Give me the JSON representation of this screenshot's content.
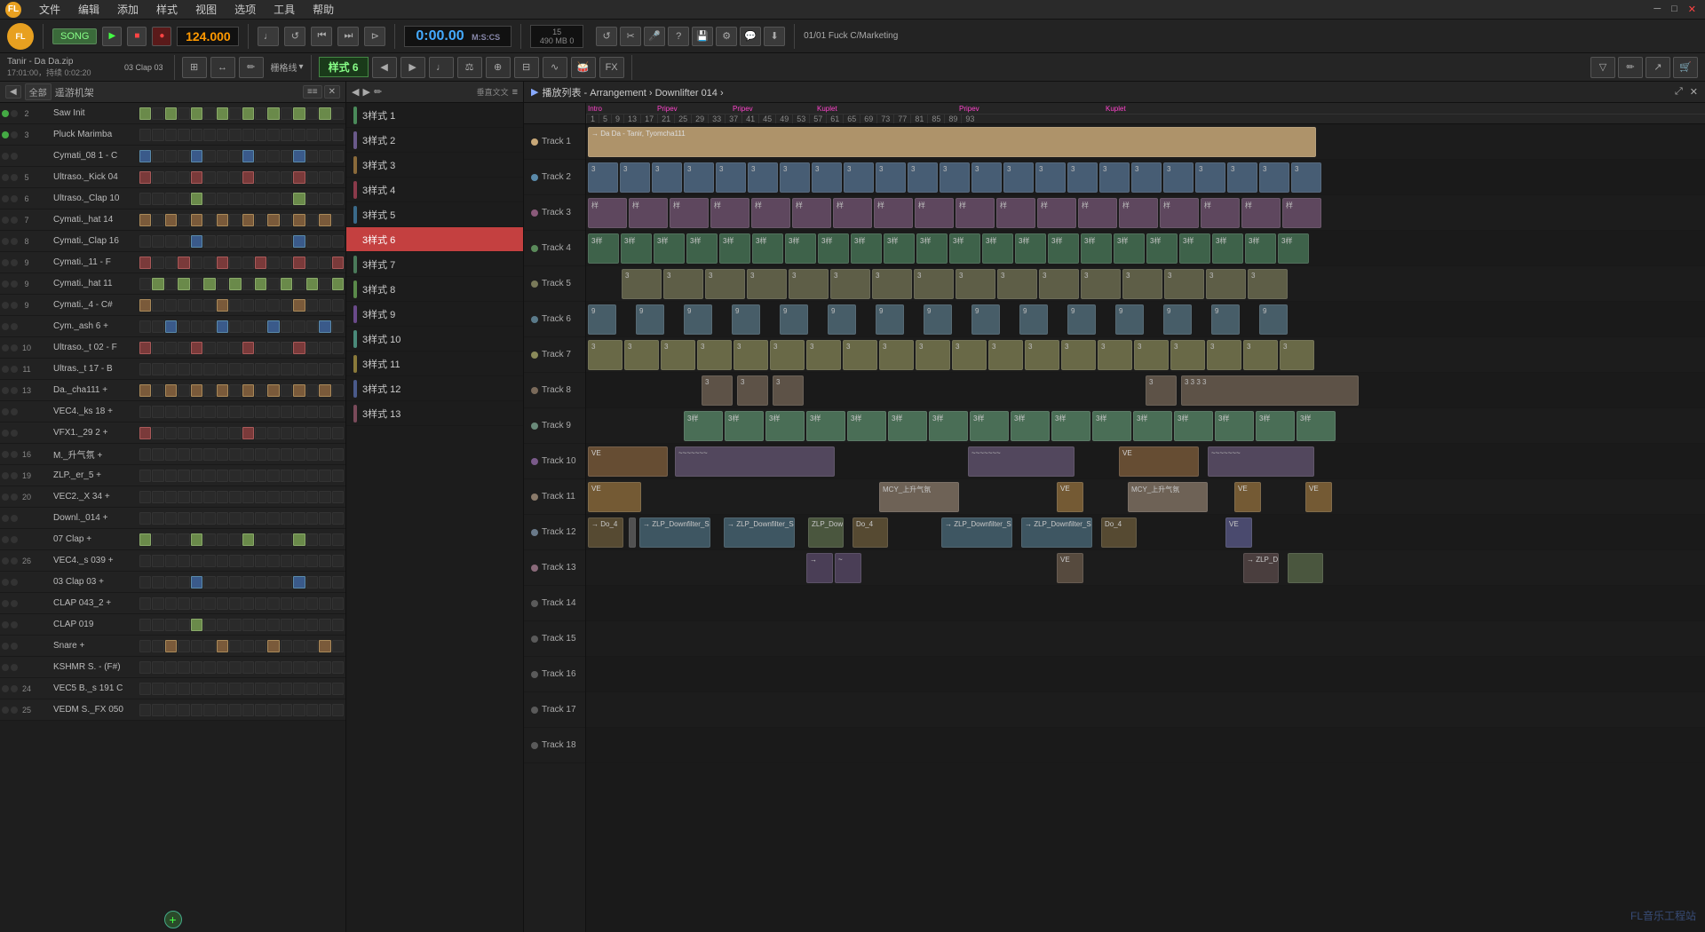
{
  "menu": {
    "items": [
      "文件",
      "编辑",
      "添加",
      "样式",
      "视图",
      "选项",
      "工具",
      "帮助"
    ]
  },
  "transport": {
    "song_label": "SONG",
    "bpm": "124.000",
    "time": "0:00.00",
    "time_unit": "M:S:CS",
    "beats": "15",
    "memory": "490 MB\n0",
    "record_btn": "●",
    "play_btn": "▶",
    "stop_btn": "■",
    "pattern_btn": "样式 6",
    "project_info": "01/01  Fuck C/Marketing"
  },
  "left_panel": {
    "header_btns": [
      "◀",
      "全部",
      "遥游机架"
    ],
    "add_btn": "+"
  },
  "channels": [
    {
      "num": "2",
      "name": "Saw Init",
      "green": true,
      "steps": [
        1,
        0,
        1,
        0,
        1,
        0,
        1,
        0,
        1,
        0,
        1,
        0,
        1,
        0,
        1,
        0
      ]
    },
    {
      "num": "3",
      "name": "Pluck Marimba",
      "green": true,
      "steps": [
        0,
        0,
        0,
        0,
        0,
        0,
        0,
        0,
        0,
        0,
        0,
        0,
        0,
        0,
        0,
        0
      ]
    },
    {
      "num": "",
      "name": "Cymati_08 1 - C",
      "green": false,
      "steps": [
        1,
        0,
        0,
        0,
        1,
        0,
        0,
        0,
        1,
        0,
        0,
        0,
        1,
        0,
        0,
        0
      ]
    },
    {
      "num": "5",
      "name": "Ultraso._Kick 04",
      "green": false,
      "steps": [
        1,
        0,
        0,
        0,
        1,
        0,
        0,
        0,
        1,
        0,
        0,
        0,
        1,
        0,
        0,
        0
      ]
    },
    {
      "num": "6",
      "name": "Ultraso._Clap 10",
      "green": false,
      "steps": [
        0,
        0,
        0,
        0,
        1,
        0,
        0,
        0,
        0,
        0,
        0,
        0,
        1,
        0,
        0,
        0
      ]
    },
    {
      "num": "7",
      "name": "Cymati._hat 14",
      "green": false,
      "steps": [
        1,
        0,
        1,
        0,
        1,
        0,
        1,
        0,
        1,
        0,
        1,
        0,
        1,
        0,
        1,
        0
      ]
    },
    {
      "num": "8",
      "name": "Cymati._Clap 16",
      "green": false,
      "steps": [
        0,
        0,
        0,
        0,
        1,
        0,
        0,
        0,
        0,
        0,
        0,
        0,
        1,
        0,
        0,
        0
      ]
    },
    {
      "num": "9",
      "name": "Cymati._11 - F",
      "green": false,
      "steps": [
        1,
        0,
        0,
        1,
        0,
        0,
        1,
        0,
        0,
        1,
        0,
        0,
        1,
        0,
        0,
        1
      ]
    },
    {
      "num": "9",
      "name": "Cymati._hat 11",
      "green": false,
      "steps": [
        0,
        1,
        0,
        1,
        0,
        1,
        0,
        1,
        0,
        1,
        0,
        1,
        0,
        1,
        0,
        1
      ]
    },
    {
      "num": "9",
      "name": "Cymati._4 - C#",
      "green": false,
      "steps": [
        1,
        0,
        0,
        0,
        0,
        0,
        1,
        0,
        0,
        0,
        0,
        0,
        1,
        0,
        0,
        0
      ]
    },
    {
      "num": "",
      "name": "Cym._ash 6 +",
      "green": false,
      "steps": [
        0,
        0,
        1,
        0,
        0,
        0,
        1,
        0,
        0,
        0,
        1,
        0,
        0,
        0,
        1,
        0
      ]
    },
    {
      "num": "10",
      "name": "Ultraso._t 02 - F",
      "green": false,
      "steps": [
        1,
        0,
        0,
        0,
        1,
        0,
        0,
        0,
        1,
        0,
        0,
        0,
        1,
        0,
        0,
        0
      ]
    },
    {
      "num": "11",
      "name": "Ultras._t 17 - B",
      "green": false,
      "steps": [
        0,
        0,
        0,
        0,
        0,
        0,
        0,
        0,
        0,
        0,
        0,
        0,
        0,
        0,
        0,
        0
      ]
    },
    {
      "num": "13",
      "name": "Da._cha111 +",
      "green": false,
      "steps": [
        1,
        0,
        1,
        0,
        1,
        0,
        1,
        0,
        1,
        0,
        1,
        0,
        1,
        0,
        1,
        0
      ]
    },
    {
      "num": "",
      "name": "VEC4._ks 18 +",
      "green": false,
      "steps": [
        0,
        0,
        0,
        0,
        0,
        0,
        0,
        0,
        0,
        0,
        0,
        0,
        0,
        0,
        0,
        0
      ]
    },
    {
      "num": "",
      "name": "VFX1._29 2 +",
      "green": false,
      "steps": [
        1,
        0,
        0,
        0,
        0,
        0,
        0,
        0,
        1,
        0,
        0,
        0,
        0,
        0,
        0,
        0
      ]
    },
    {
      "num": "16",
      "name": "M._升气氛 +",
      "green": false,
      "steps": [
        0,
        0,
        0,
        0,
        0,
        0,
        0,
        0,
        0,
        0,
        0,
        0,
        0,
        0,
        0,
        0
      ]
    },
    {
      "num": "19",
      "name": "ZLP._er_5 +",
      "green": false,
      "steps": [
        0,
        0,
        0,
        0,
        0,
        0,
        0,
        0,
        0,
        0,
        0,
        0,
        0,
        0,
        0,
        0
      ]
    },
    {
      "num": "20",
      "name": "VEC2._X 34 +",
      "green": false,
      "steps": [
        0,
        0,
        0,
        0,
        0,
        0,
        0,
        0,
        0,
        0,
        0,
        0,
        0,
        0,
        0,
        0
      ]
    },
    {
      "num": "",
      "name": "Downl._014 +",
      "green": false,
      "steps": [
        0,
        0,
        0,
        0,
        0,
        0,
        0,
        0,
        0,
        0,
        0,
        0,
        0,
        0,
        0,
        0
      ]
    },
    {
      "num": "",
      "name": "07 Clap +",
      "green": false,
      "steps": [
        1,
        0,
        0,
        0,
        1,
        0,
        0,
        0,
        1,
        0,
        0,
        0,
        1,
        0,
        0,
        0
      ]
    },
    {
      "num": "26",
      "name": "VEC4._s 039 +",
      "green": false,
      "steps": [
        0,
        0,
        0,
        0,
        0,
        0,
        0,
        0,
        0,
        0,
        0,
        0,
        0,
        0,
        0,
        0
      ]
    },
    {
      "num": "",
      "name": "03 Clap 03 +",
      "green": false,
      "steps": [
        0,
        0,
        0,
        0,
        1,
        0,
        0,
        0,
        0,
        0,
        0,
        0,
        1,
        0,
        0,
        0
      ]
    },
    {
      "num": "",
      "name": "CLAP 043_2 +",
      "green": false,
      "steps": [
        0,
        0,
        0,
        0,
        0,
        0,
        0,
        0,
        0,
        0,
        0,
        0,
        0,
        0,
        0,
        0
      ]
    },
    {
      "num": "",
      "name": "CLAP 019",
      "green": false,
      "steps": [
        0,
        0,
        0,
        0,
        1,
        0,
        0,
        0,
        0,
        0,
        0,
        0,
        0,
        0,
        0,
        0
      ]
    },
    {
      "num": "",
      "name": "Snare +",
      "green": false,
      "steps": [
        0,
        0,
        1,
        0,
        0,
        0,
        1,
        0,
        0,
        0,
        1,
        0,
        0,
        0,
        1,
        0
      ]
    },
    {
      "num": "",
      "name": "KSHMR S. - (F#)",
      "green": false,
      "steps": [
        0,
        0,
        0,
        0,
        0,
        0,
        0,
        0,
        0,
        0,
        0,
        0,
        0,
        0,
        0,
        0
      ]
    },
    {
      "num": "24",
      "name": "VEC5 B._s 191 C",
      "green": false,
      "steps": [
        0,
        0,
        0,
        0,
        0,
        0,
        0,
        0,
        0,
        0,
        0,
        0,
        0,
        0,
        0,
        0
      ]
    },
    {
      "num": "25",
      "name": "VEDM S._FX 050",
      "green": false,
      "steps": [
        0,
        0,
        0,
        0,
        0,
        0,
        0,
        0,
        0,
        0,
        0,
        0,
        0,
        0,
        0,
        0
      ]
    }
  ],
  "patterns": [
    {
      "label": "3样式 1",
      "color": "#4a8a5a",
      "active": false
    },
    {
      "label": "3样式 2",
      "color": "#6a5a8a",
      "active": false
    },
    {
      "label": "3样式 3",
      "color": "#8a6a3a",
      "active": false
    },
    {
      "label": "3样式 4",
      "color": "#8a3a4a",
      "active": false
    },
    {
      "label": "3样式 5",
      "color": "#3a6a8a",
      "active": false
    },
    {
      "label": "3样式 6",
      "color": "#c44040",
      "active": true
    },
    {
      "label": "3样式 7",
      "color": "#4a7a5a",
      "active": false
    },
    {
      "label": "3样式 8",
      "color": "#5a8a4a",
      "active": false
    },
    {
      "label": "3样式 9",
      "color": "#6a4a8a",
      "active": false
    },
    {
      "label": "3样式 10",
      "color": "#4a8a7a",
      "active": false
    },
    {
      "label": "3样式 11",
      "color": "#8a7a3a",
      "active": false
    },
    {
      "label": "3样式 12",
      "color": "#4a5a8a",
      "active": false
    },
    {
      "label": "3样式 13",
      "color": "#7a4a5a",
      "active": false
    }
  ],
  "arrangement": {
    "title": "播放列表 - Arrangement › Downlifter 014 ›",
    "breadcrumb_parts": [
      "播放列表 - Arrangement",
      "Downlifter 014"
    ],
    "ruler_labels": [
      "1",
      "5",
      "9",
      "13",
      "17",
      "21",
      "25",
      "29",
      "33",
      "37",
      "41",
      "45",
      "49",
      "53",
      "57",
      "61",
      "65",
      "69",
      "73",
      "77",
      "81",
      "85",
      "89",
      "93"
    ],
    "section_labels": [
      {
        "label": "Intro",
        "pos": 0
      },
      {
        "label": "Pripev",
        "pos": 8
      },
      {
        "label": "Pripev",
        "pos": 16
      },
      {
        "label": "Kuplet",
        "pos": 24
      },
      {
        "label": "Pripev",
        "pos": 38
      },
      {
        "label": "Kuplet",
        "pos": 54
      }
    ],
    "tracks": [
      {
        "label": "Track 1",
        "color": "#c8a878"
      },
      {
        "label": "Track 2",
        "color": "#5a8aaa"
      },
      {
        "label": "Track 3",
        "color": "#8a5a7a"
      },
      {
        "label": "Track 4",
        "color": "#5a8a5a"
      },
      {
        "label": "Track 5",
        "color": "#7a7a5a"
      },
      {
        "label": "Track 6",
        "color": "#5a7a8a"
      },
      {
        "label": "Track 7",
        "color": "#8a8a5a"
      },
      {
        "label": "Track 8",
        "color": "#7a6a5a"
      },
      {
        "label": "Track 9",
        "color": "#6a8a7a"
      },
      {
        "label": "Track 10",
        "color": "#7a5a8a"
      },
      {
        "label": "Track 11",
        "color": "#8a7a6a"
      },
      {
        "label": "Track 12",
        "color": "#6a7a8a"
      },
      {
        "label": "Track 13",
        "color": "#8a6a7a"
      },
      {
        "label": "Track 14",
        "color": "#5a5a5a"
      },
      {
        "label": "Track 15",
        "color": "#5a5a5a"
      },
      {
        "label": "Track 16",
        "color": "#5a5a5a"
      },
      {
        "label": "Track 17",
        "color": "#5a5a5a"
      },
      {
        "label": "Track 18",
        "color": "#5a5a5a"
      }
    ]
  },
  "project": {
    "title": "Tanir - Da Da.zip",
    "duration": "17:01:00，持续 0:02:20",
    "selected_channel": "03 Clap 03"
  },
  "watermark": "FL音乐工程站"
}
